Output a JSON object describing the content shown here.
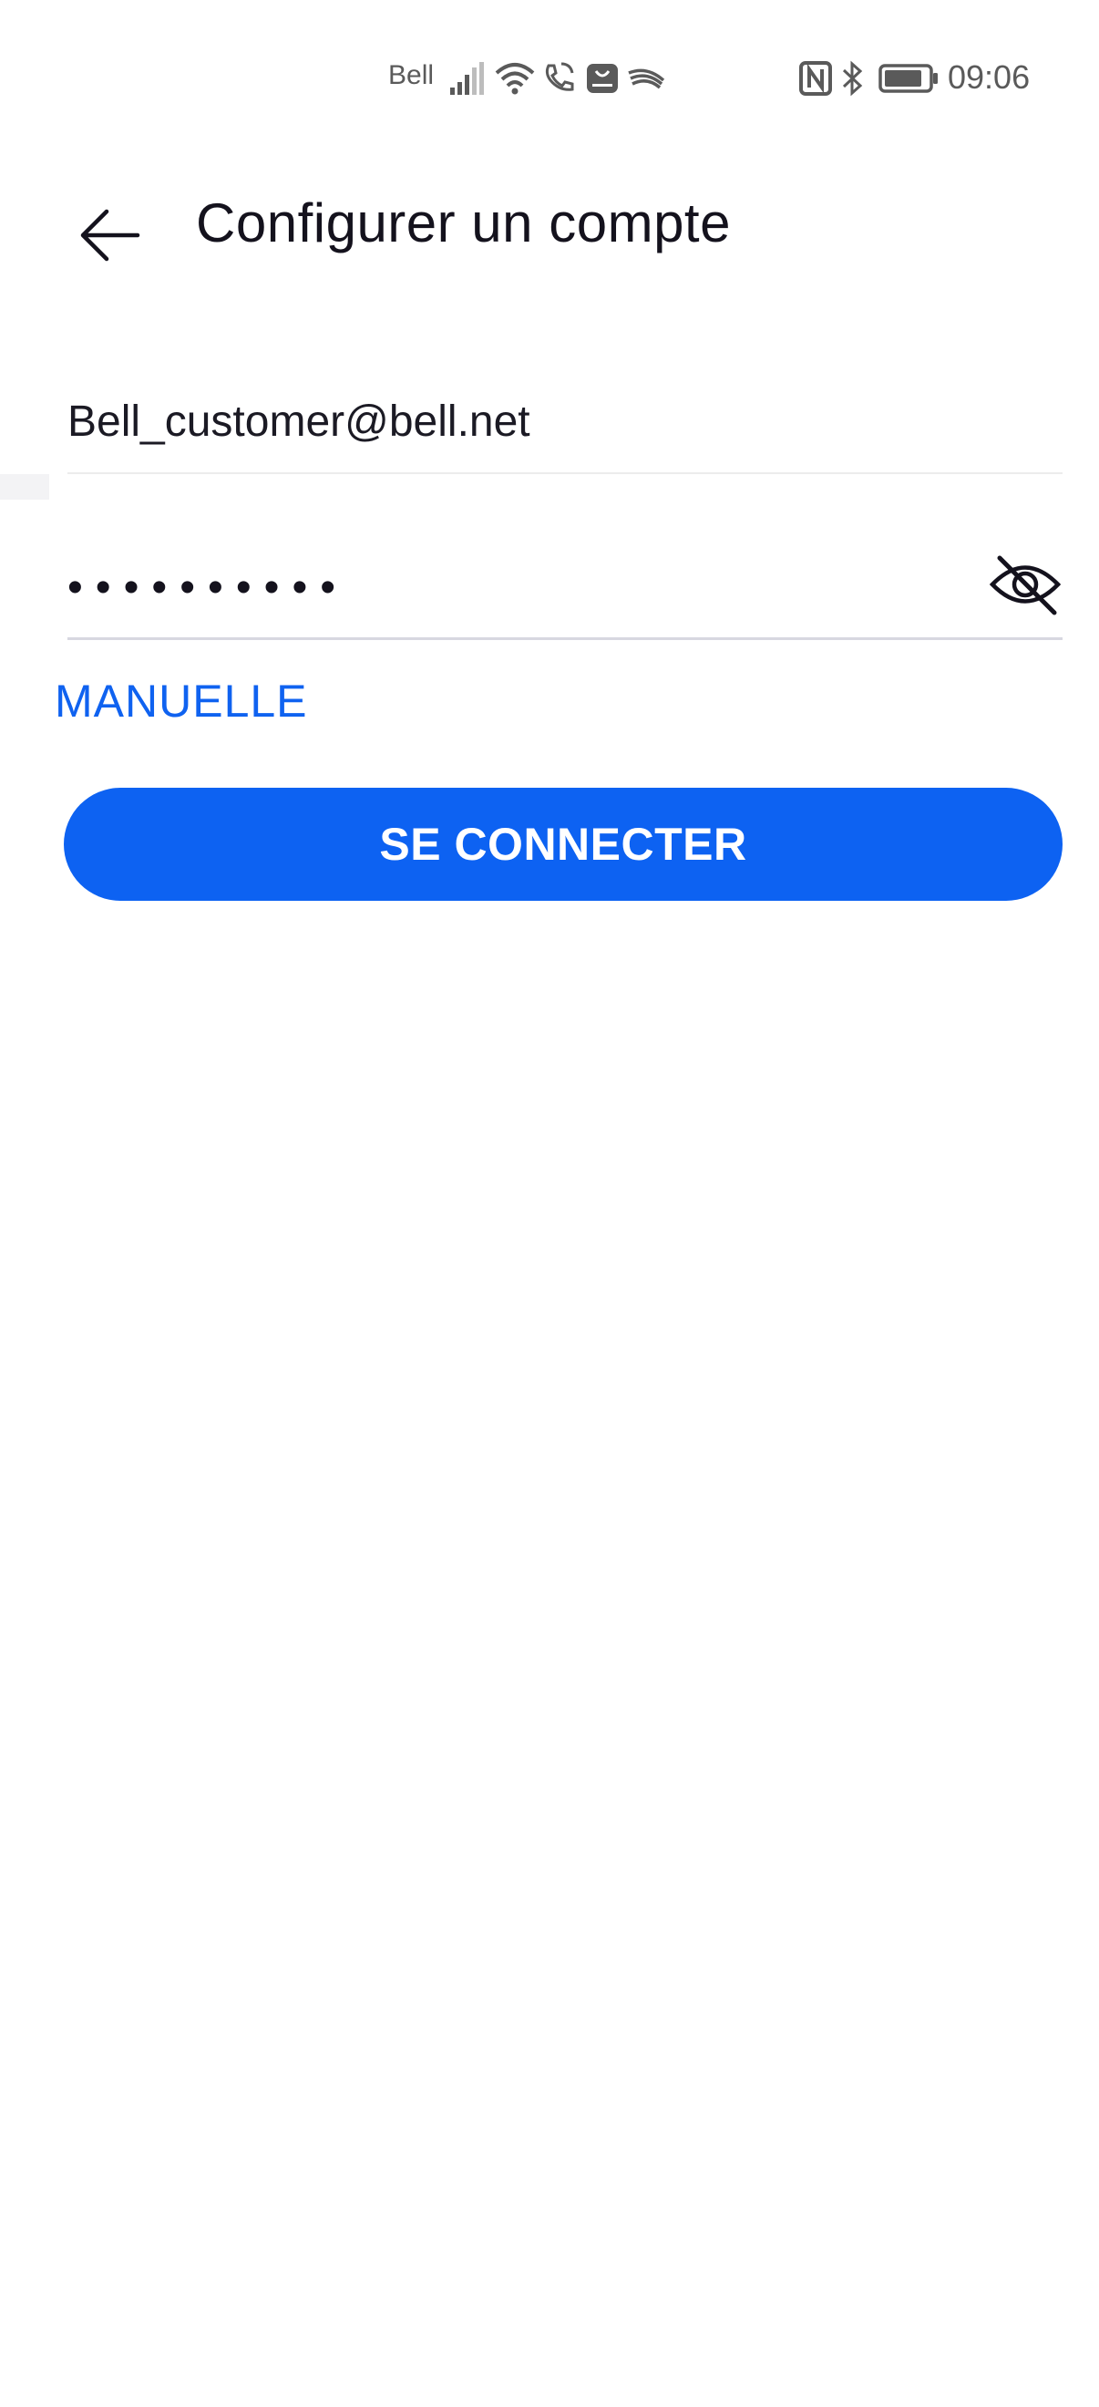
{
  "status_bar": {
    "carrier": "Bell",
    "time": "09:06",
    "icons": [
      "signal-icon",
      "wifi-icon",
      "wifi-calling-icon",
      "huawei-app-icon",
      "swiftkey-icon",
      "nfc-icon",
      "bluetooth-icon",
      "battery-icon"
    ]
  },
  "app_bar": {
    "title": "Configurer un compte",
    "back_icon": "arrow-left-icon"
  },
  "form": {
    "email_value": "Bell_customer@bell.net",
    "password_value": "••••••••••",
    "password_toggle_icon": "eye-off-icon",
    "manual_label": "MANUELLE",
    "connect_label": "SE CONNECTER"
  },
  "colors": {
    "accent": "#0d62f2",
    "link": "#0f62f0",
    "text": "#14121d"
  }
}
